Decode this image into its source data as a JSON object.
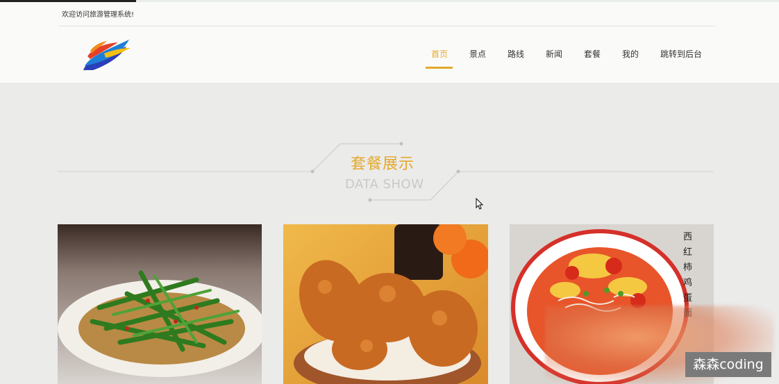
{
  "header": {
    "welcome_text": "欢迎访问旅游管理系统!",
    "nav": [
      {
        "label": "首页",
        "active": true
      },
      {
        "label": "景点",
        "active": false
      },
      {
        "label": "路线",
        "active": false
      },
      {
        "label": "新闻",
        "active": false
      },
      {
        "label": "套餐",
        "active": false
      },
      {
        "label": "我的",
        "active": false
      },
      {
        "label": "跳转到后台",
        "active": false
      }
    ]
  },
  "section": {
    "title_cn": "套餐展示",
    "title_en": "DATA SHOW"
  },
  "cards": [
    {
      "image": "stir-fried-greens-dish"
    },
    {
      "image": "fried-chicken-basket"
    },
    {
      "image": "tomato-egg-noodle-bowl",
      "image_text": "西红柿鸡蛋面"
    }
  ],
  "watermark": "森森coding",
  "colors": {
    "accent": "#e5a82a",
    "background": "#ebebea",
    "header_bg": "#fafbf9"
  }
}
